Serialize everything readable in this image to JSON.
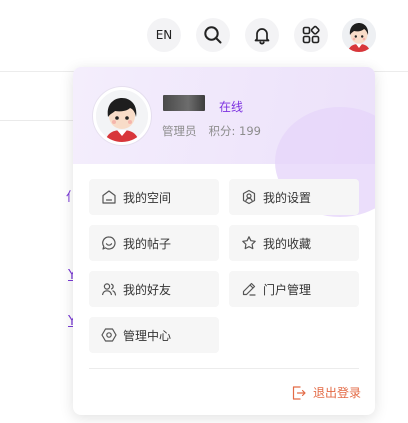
{
  "topbar": {
    "lang_label": "EN"
  },
  "user": {
    "status": "在线",
    "role": "管理员",
    "points_label": "积分: 199"
  },
  "menu": {
    "items": [
      {
        "label": "我的空间",
        "icon": "home-icon"
      },
      {
        "label": "我的设置",
        "icon": "user-settings-icon"
      },
      {
        "label": "我的帖子",
        "icon": "chat-icon"
      },
      {
        "label": "我的收藏",
        "icon": "star-icon"
      },
      {
        "label": "我的好友",
        "icon": "friends-icon"
      },
      {
        "label": "门户管理",
        "icon": "edit-icon"
      },
      {
        "label": "管理中心",
        "icon": "hexagon-settings-icon"
      }
    ],
    "logout_label": "退出登录"
  },
  "background": {
    "fragment_1": "仆",
    "fragment_2": "Y",
    "fragment_3": "Y"
  },
  "colors": {
    "accent": "#7d32e0",
    "logout": "#e36a45",
    "header_bg": "#efe6fb"
  }
}
